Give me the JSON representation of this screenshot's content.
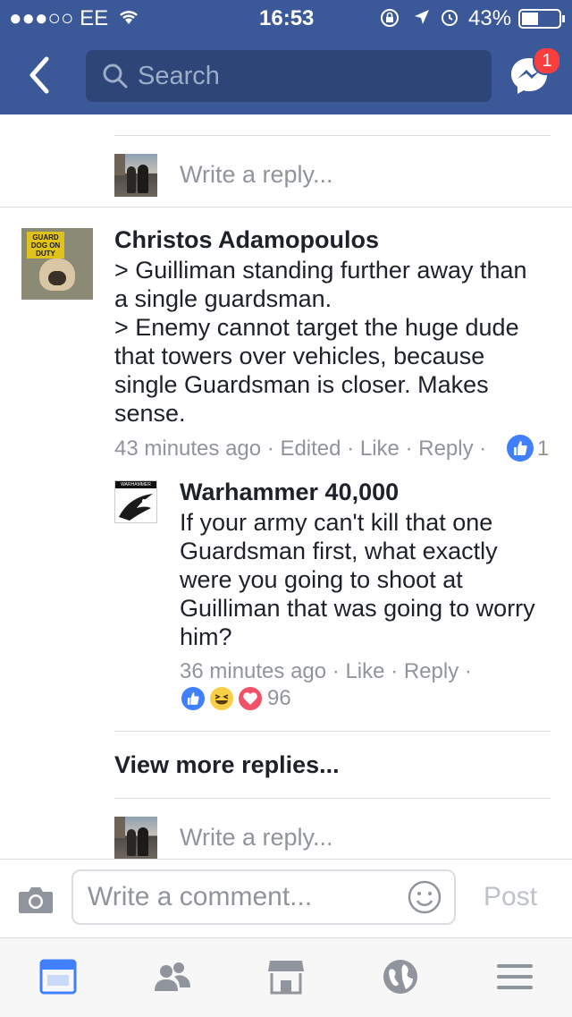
{
  "status_bar": {
    "carrier": "●●●○○ EE",
    "time": "16:53",
    "battery": "43%"
  },
  "nav": {
    "search_placeholder": "Search",
    "messenger_badge": "1"
  },
  "thread": {
    "reply_placeholder": "Write a reply...",
    "comment": {
      "author": "Christos Adamopoulos",
      "avatar_sign": "GUARD DOG ON DUTY",
      "text": "> Guilliman standing further away than a single guardsman.\n> Enemy cannot target the huge dude that towers over vehicles, because single Guardsman is closer. Makes sense.",
      "time": "43 minutes ago",
      "edited": "Edited",
      "like": "Like",
      "reply": "Reply",
      "like_count": "1"
    },
    "reply": {
      "author": "Warhammer 40,000",
      "avatar_text": "WARHAMMER",
      "text": "If your army can't kill that one Guardsman first, what exactly were you going to shoot at Guilliman that was going to worry him?",
      "time": "36 minutes ago",
      "like": "Like",
      "reply": "Reply",
      "reaction_count": "96"
    },
    "view_more": "View more replies...",
    "reply_placeholder_2": "Write a reply..."
  },
  "comment_bar": {
    "placeholder": "Write a comment...",
    "post_label": "Post"
  },
  "colors": {
    "brand": "#3b5998",
    "like_blue": "#4080ff",
    "love_red": "#f25268",
    "haha_yellow": "#f7d046"
  }
}
